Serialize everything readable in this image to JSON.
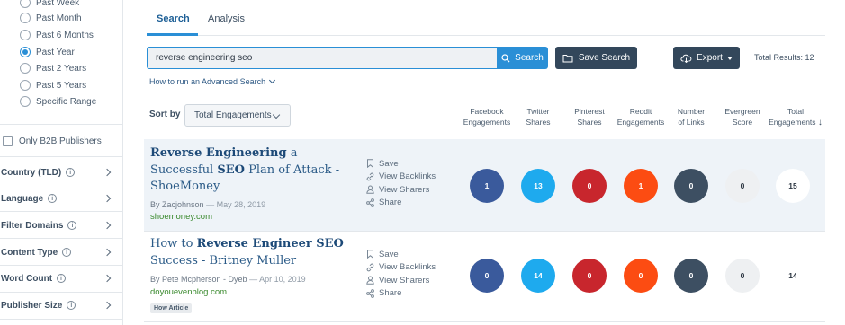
{
  "sidebar": {
    "date_options": [
      {
        "label": "Past Week",
        "checked": false
      },
      {
        "label": "Past Month",
        "checked": false
      },
      {
        "label": "Past 6 Months",
        "checked": false
      },
      {
        "label": "Past Year",
        "checked": true
      },
      {
        "label": "Past 2 Years",
        "checked": false
      },
      {
        "label": "Past 5 Years",
        "checked": false
      },
      {
        "label": "Specific Range",
        "checked": false
      }
    ],
    "b2b_label": "Only B2B Publishers",
    "filters": [
      {
        "label": "Country (TLD)"
      },
      {
        "label": "Language"
      },
      {
        "label": "Filter Domains"
      },
      {
        "label": "Content Type"
      },
      {
        "label": "Word Count"
      },
      {
        "label": "Publisher Size"
      }
    ]
  },
  "tabs": [
    {
      "label": "Search",
      "active": true
    },
    {
      "label": "Analysis",
      "active": false
    }
  ],
  "search": {
    "value": "reverse engineering seo",
    "button_label": "Search",
    "save_label": "Save Search",
    "export_label": "Export",
    "total_results": "Total Results: 12",
    "advanced_link": "How to run an Advanced Search"
  },
  "sort": {
    "label": "Sort by",
    "selected": "Total Engagements"
  },
  "columns": [
    {
      "line1": "Facebook",
      "line2": "Engagements"
    },
    {
      "line1": "Twitter",
      "line2": "Shares"
    },
    {
      "line1": "Pinterest",
      "line2": "Shares"
    },
    {
      "line1": "Reddit",
      "line2": "Engagements"
    },
    {
      "line1": "Number",
      "line2": "of Links"
    },
    {
      "line1": "Evergreen",
      "line2": "Score"
    },
    {
      "line1": "Total",
      "line2": "Engagements"
    }
  ],
  "actions": {
    "save": "Save",
    "backlinks": "View Backlinks",
    "sharers": "View Sharers",
    "share": "Share"
  },
  "results": [
    {
      "title_parts": [
        {
          "text": "Reverse Engineering",
          "bold": true
        },
        {
          "text": " a Successful ",
          "bold": false
        },
        {
          "text": "SEO",
          "bold": true
        },
        {
          "text": " Plan of Attack - ShoeMoney",
          "bold": false
        }
      ],
      "author": "By Zacjohnson",
      "date": "May 28, 2019",
      "domain": "shoemoney.com",
      "badge": "",
      "metrics": {
        "facebook": "1",
        "twitter": "13",
        "pinterest": "0",
        "reddit": "1",
        "links": "0",
        "evergreen": "0",
        "total": "15"
      }
    },
    {
      "title_parts": [
        {
          "text": "How to ",
          "bold": false
        },
        {
          "text": "Reverse Engineer SEO",
          "bold": true
        },
        {
          "text": " Success - Britney Muller",
          "bold": false
        }
      ],
      "author": "By Pete Mcpherson - Dyeb",
      "date": "Apr 10, 2019",
      "domain": "doyouevenblog.com",
      "badge": "How Article",
      "metrics": {
        "facebook": "0",
        "twitter": "14",
        "pinterest": "0",
        "reddit": "0",
        "links": "0",
        "evergreen": "0",
        "total": "14"
      }
    }
  ]
}
